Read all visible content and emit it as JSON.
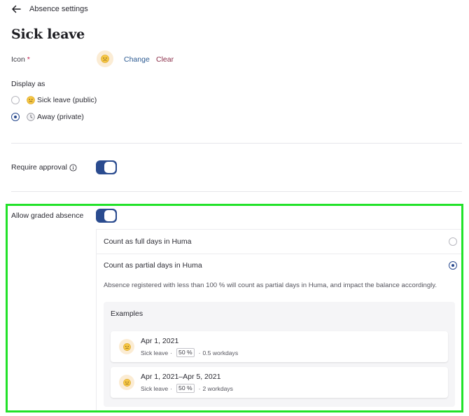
{
  "header": {
    "title": "Absence settings",
    "back_icon": "arrow-left-icon"
  },
  "page": {
    "title": "Sick leave"
  },
  "icon_field": {
    "label": "Icon",
    "required_mark": "*",
    "current_icon": "sick-face-emoji",
    "change_label": "Change",
    "clear_label": "Clear"
  },
  "display_as": {
    "label": "Display as",
    "options": [
      {
        "label": "Sick leave (public)",
        "icon": "sick-face-emoji",
        "selected": false
      },
      {
        "label": "Away (private)",
        "icon": "clock-emoji",
        "selected": true
      }
    ]
  },
  "require_approval": {
    "label": "Require approval",
    "info_icon": "info-icon",
    "enabled": true
  },
  "graded_absence": {
    "label": "Allow graded absence",
    "enabled": true,
    "options": [
      {
        "label": "Count as full days in Huma",
        "selected": false
      },
      {
        "label": "Count as partial days in Huma",
        "selected": true
      }
    ],
    "description": "Absence registered with less than 100 % will count as partial days in Huma, and impact the balance accordingly.",
    "examples": {
      "title": "Examples",
      "items": [
        {
          "date": "Apr 1, 2021",
          "type": "Sick leave",
          "percent": "50 %",
          "duration": "0.5 workdays",
          "separator": "·"
        },
        {
          "date": "Apr 1, 2021–Apr 5, 2021",
          "type": "Sick leave",
          "percent": "50 %",
          "duration": "2 workdays",
          "separator": "·"
        }
      ]
    }
  },
  "colors": {
    "accent": "#2a4b8f",
    "change_link": "#2c5a91",
    "clear_link": "#8a2d48",
    "highlight": "#22e22a",
    "emoji_bg": "#fbecd4"
  }
}
